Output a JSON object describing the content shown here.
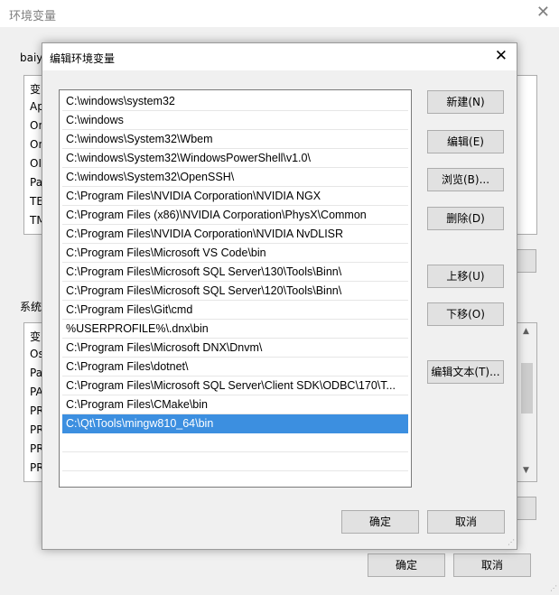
{
  "background_window": {
    "title": "环境变量",
    "user_vars_label": "baiy",
    "user_rows": [
      "变",
      "Ap",
      "On",
      "On",
      "OI",
      "Pa",
      "TE",
      "TM"
    ],
    "system_vars_label": "系统",
    "system_rows": [
      "变",
      "Os",
      "Pa",
      "PA",
      "PR",
      "PR",
      "PR",
      "PR"
    ],
    "ok_label": "确定",
    "cancel_label": "取消"
  },
  "dialog": {
    "title": "编辑环境变量",
    "paths": [
      "C:\\windows\\system32",
      "C:\\windows",
      "C:\\windows\\System32\\Wbem",
      "C:\\windows\\System32\\WindowsPowerShell\\v1.0\\",
      "C:\\windows\\System32\\OpenSSH\\",
      "C:\\Program Files\\NVIDIA Corporation\\NVIDIA NGX",
      "C:\\Program Files (x86)\\NVIDIA Corporation\\PhysX\\Common",
      "C:\\Program Files\\NVIDIA Corporation\\NVIDIA NvDLISR",
      "C:\\Program Files\\Microsoft VS Code\\bin",
      "C:\\Program Files\\Microsoft SQL Server\\130\\Tools\\Binn\\",
      "C:\\Program Files\\Microsoft SQL Server\\120\\Tools\\Binn\\",
      "C:\\Program Files\\Git\\cmd",
      "%USERPROFILE%\\.dnx\\bin",
      "C:\\Program Files\\Microsoft DNX\\Dnvm\\",
      "C:\\Program Files\\dotnet\\",
      "C:\\Program Files\\Microsoft SQL Server\\Client SDK\\ODBC\\170\\T...",
      "C:\\Program Files\\CMake\\bin",
      "C:\\Qt\\Tools\\mingw810_64\\bin"
    ],
    "selected_index": 17,
    "buttons": {
      "new": "新建(N)",
      "edit": "编辑(E)",
      "browse": "浏览(B)...",
      "delete": "删除(D)",
      "move_up": "上移(U)",
      "move_down": "下移(O)",
      "edit_text": "编辑文本(T)..."
    },
    "ok_label": "确定",
    "cancel_label": "取消"
  },
  "colors": {
    "selection": "#3c8fe0"
  }
}
